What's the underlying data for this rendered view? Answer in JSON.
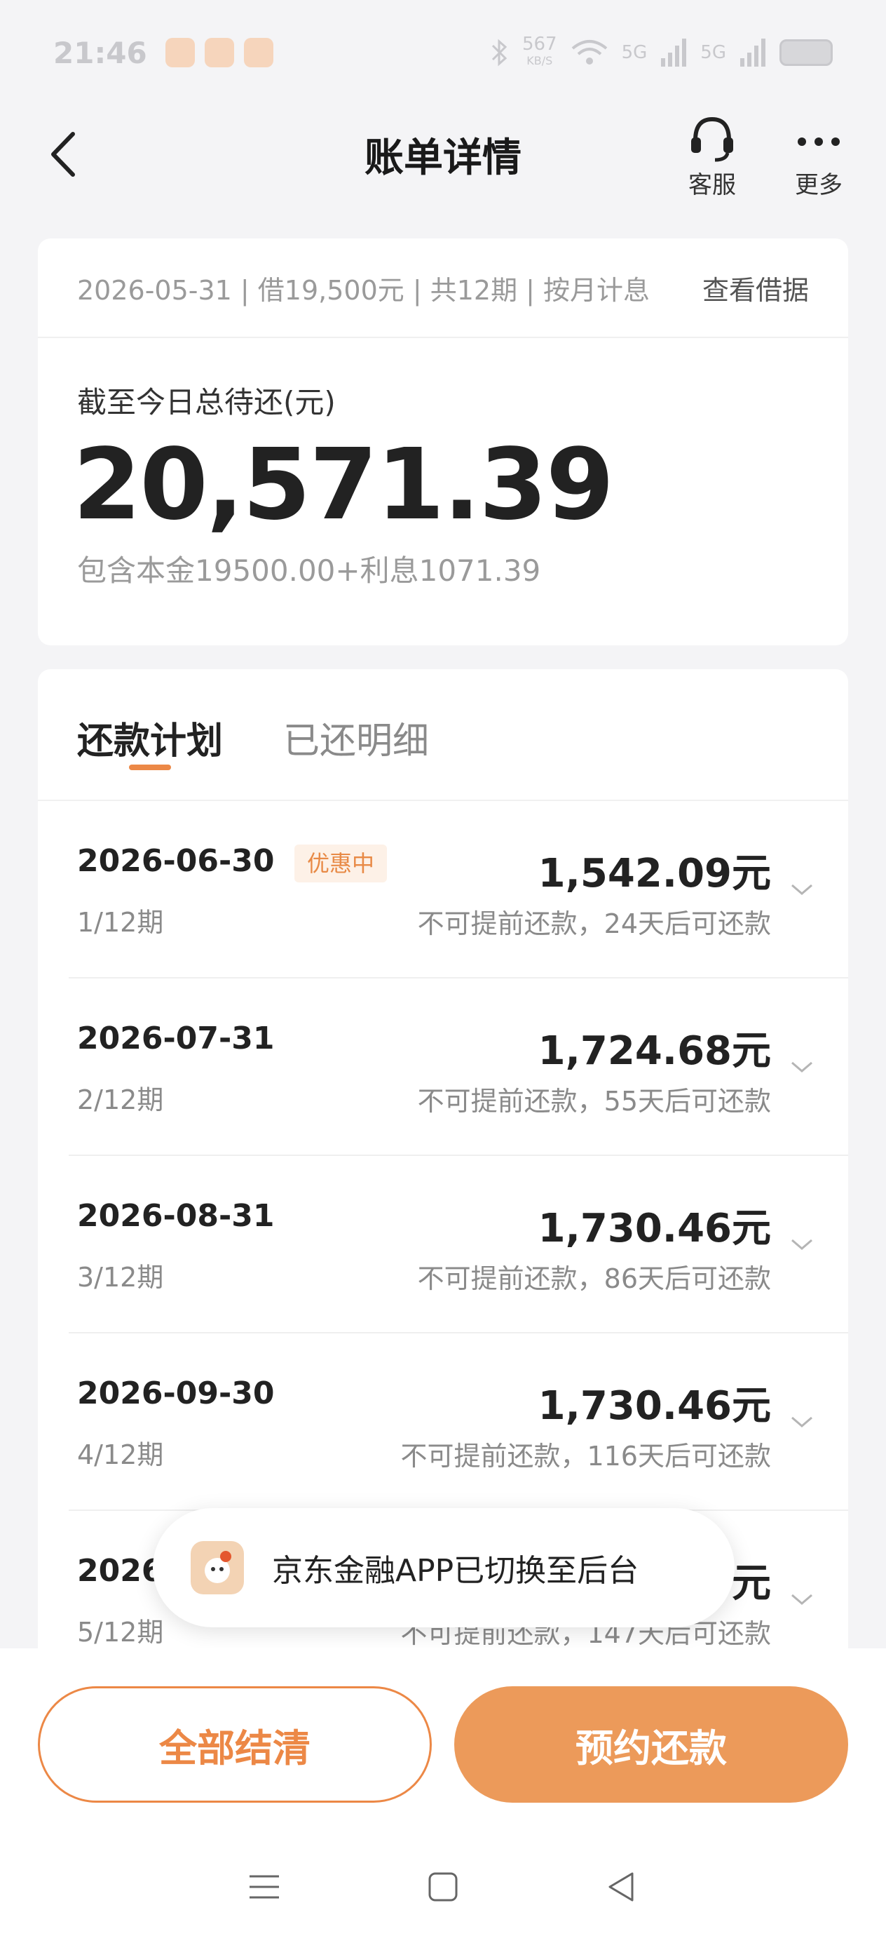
{
  "status_bar": {
    "time": "21:46",
    "net_speed_value": "567",
    "net_speed_unit": "KB/S",
    "signal_1": "5G",
    "signal_2": "5G"
  },
  "header": {
    "title": "账单详情",
    "service_label": "客服",
    "more_label": "更多"
  },
  "summary": {
    "loan_meta": "2026-05-31 | 借19,500元 | 共12期 | 按月计息",
    "view_receipt": "查看借据",
    "due_label": "截至今日总待还(元)",
    "due_amount": "20,571.39",
    "breakdown": "包含本金19500.00+利息1071.39"
  },
  "tabs": [
    {
      "label": "还款计划",
      "active": true
    },
    {
      "label": "已还明细",
      "active": false
    }
  ],
  "plan_rows": [
    {
      "date": "2026-06-30",
      "badge": "优惠中",
      "period": "1/12期",
      "amount": "1,542.09元",
      "note": "不可提前还款，24天后可还款"
    },
    {
      "date": "2026-07-31",
      "badge": "",
      "period": "2/12期",
      "amount": "1,724.68元",
      "note": "不可提前还款，55天后可还款"
    },
    {
      "date": "2026-08-31",
      "badge": "",
      "period": "3/12期",
      "amount": "1,730.46元",
      "note": "不可提前还款，86天后可还款"
    },
    {
      "date": "2026-09-30",
      "badge": "",
      "period": "4/12期",
      "amount": "1,730.46元",
      "note": "不可提前还款，116天后可还款"
    },
    {
      "date": "2026-",
      "badge": "",
      "period": "5/12期",
      "amount": "元",
      "note": "不可提前还款，147天后可还款"
    }
  ],
  "toast": {
    "text": "京东金融APP已切换至后台"
  },
  "buttons": {
    "settle_all": "全部结清",
    "schedule_repay": "预约还款"
  },
  "colors": {
    "accent": "#ec8846",
    "accent_fill": "#ec9a5a",
    "badge_bg": "#fdf1e7"
  }
}
